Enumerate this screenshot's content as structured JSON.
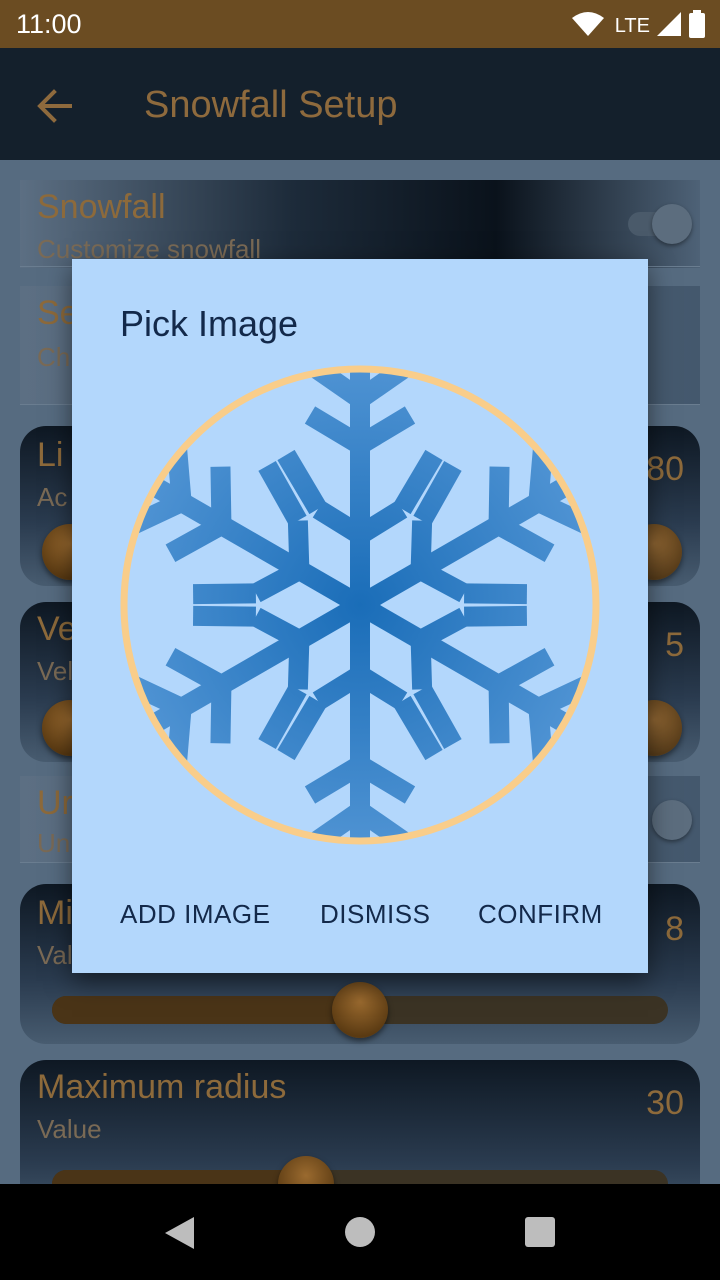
{
  "status_bar": {
    "time": "11:00",
    "network": "LTE"
  },
  "app_bar": {
    "title": "Snowfall Setup",
    "back_icon": "arrow-back-icon"
  },
  "settings": {
    "snowfall": {
      "title": "Snowfall",
      "subtitle": "Customize snowfall"
    },
    "select": {
      "title": "Se",
      "subtitle": "Ch"
    },
    "limit": {
      "title": "Li",
      "subtitle": "Ac",
      "value": "80"
    },
    "velocity": {
      "title": "Ve",
      "subtitle": "Vel",
      "value": "5"
    },
    "uniform": {
      "title": "Ur",
      "subtitle": "Uni"
    },
    "min_radius": {
      "title": "Mi",
      "subtitle": "Val",
      "value": "8",
      "level": 0.5
    },
    "max_radius": {
      "title": "Maximum radius",
      "subtitle": "Value",
      "value": "30",
      "level": 0.4
    }
  },
  "dialog": {
    "title": "Pick Image",
    "image_icon": "snowflake-icon",
    "buttons": {
      "add": "ADD IMAGE",
      "dismiss": "DISMISS",
      "confirm": "CONFIRM"
    }
  },
  "colors": {
    "dialog_bg": "#b3d7fc",
    "ring": "#f9cd8a",
    "snowflake": "#2f7fc6",
    "status_bar": "#6b4c22",
    "accent": "#8d6a3b"
  }
}
